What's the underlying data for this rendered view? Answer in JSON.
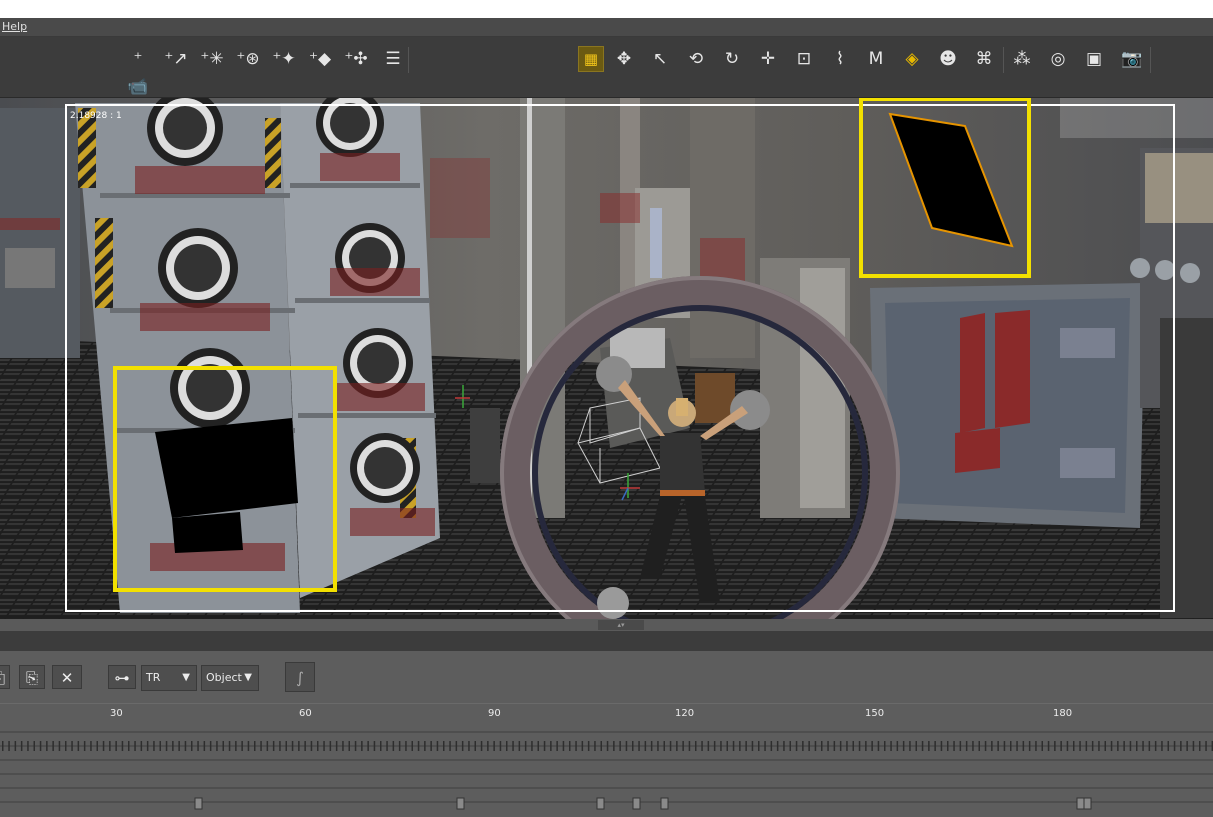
{
  "menu": {
    "help": "Help"
  },
  "toolbar": {
    "create_tools": [
      {
        "name": "create-camera-tool",
        "glyph": "⁺📹"
      },
      {
        "name": "create-distant-light-tool",
        "glyph": "⁺↗"
      },
      {
        "name": "create-point-light-tool",
        "glyph": "⁺✳"
      },
      {
        "name": "create-ambient-light-tool",
        "glyph": "⁺⊛"
      },
      {
        "name": "create-spotlight-tool",
        "glyph": "⁺✦"
      },
      {
        "name": "create-area-light-tool",
        "glyph": "⁺◆"
      },
      {
        "name": "create-null-tool",
        "glyph": "⁺✣"
      }
    ],
    "align_tool": {
      "name": "align-tool",
      "glyph": "☰"
    },
    "view_tools": [
      {
        "name": "grid-toggle-tool",
        "glyph": "▦",
        "active": true
      },
      {
        "name": "universal-tool",
        "glyph": "✥"
      },
      {
        "name": "select-tool",
        "glyph": "↖"
      },
      {
        "name": "orbit-tool",
        "glyph": "⟲"
      },
      {
        "name": "rotate-tool",
        "glyph": "↻"
      },
      {
        "name": "move-tool",
        "glyph": "✛"
      },
      {
        "name": "scale-tool",
        "glyph": "⊡"
      },
      {
        "name": "bend-tool",
        "glyph": "⌇"
      },
      {
        "name": "morph-brush-tool",
        "glyph": "M"
      },
      {
        "name": "surface-paint-tool",
        "glyph": "◈",
        "highlight": true
      },
      {
        "name": "figure-select-tool",
        "glyph": "☻"
      },
      {
        "name": "camera-frame-tool",
        "glyph": "⌘"
      },
      {
        "name": "node-select-tool",
        "glyph": "⁂"
      },
      {
        "name": "light-tool",
        "glyph": "◎"
      },
      {
        "name": "render-camera-tool",
        "glyph": "▣"
      },
      {
        "name": "render-tool",
        "glyph": "📷"
      }
    ]
  },
  "viewport": {
    "aspect_label": "2.18928 : 1"
  },
  "animation": {
    "buttons": [
      {
        "name": "copy-key-button",
        "glyph": "⎘"
      },
      {
        "name": "delete-key-button",
        "glyph": "✕"
      },
      {
        "name": "key-filter-button",
        "glyph": "⊶"
      }
    ],
    "transform_dropdown": "TR",
    "object_dropdown": "Object",
    "curve_button": "∫",
    "ruler_ticks": [
      "30",
      "60",
      "90",
      "120",
      "150",
      "180"
    ]
  }
}
